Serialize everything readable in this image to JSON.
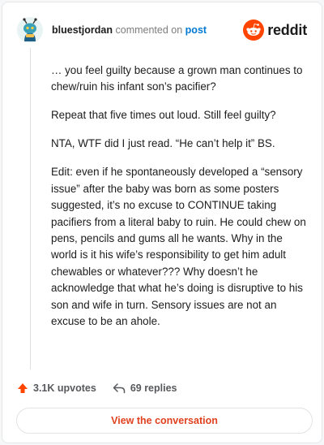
{
  "comment": {
    "username": "bluestjordan",
    "commented_text": "commented on",
    "post_link": "post",
    "paragraphs": [
      "… you feel guilty because a grown man continues to chew/ruin his infant son’s pacifier?",
      "Repeat that five times out loud. Still feel guilty?",
      "NTA, WTF did I just read. “He can’t help it” BS.",
      "Edit: even if he spontaneously developed a “sensory issue” after the baby was born as some posters suggested, it’s no excuse to CONTINUE taking pacifiers from a literal baby to ruin. He could chew on pens, pencils and gums all he wants. Why in the world is it his wife’s responsibility to get him adult chewables or whatever??? Why doesn’t he acknowledge that what he’s doing is disruptive to his son and wife in turn. Sensory issues are not an excuse to be an ahole."
    ],
    "upvotes": "3.1K upvotes",
    "replies": "69 replies"
  },
  "brand": {
    "name": "reddit",
    "icon": "reddit-logo-icon",
    "color": "#ff4500"
  },
  "cta": {
    "label": "View the conversation"
  },
  "colors": {
    "upvote": "#ff4500",
    "link": "#0079d3",
    "cta_text": "#e0411f"
  }
}
